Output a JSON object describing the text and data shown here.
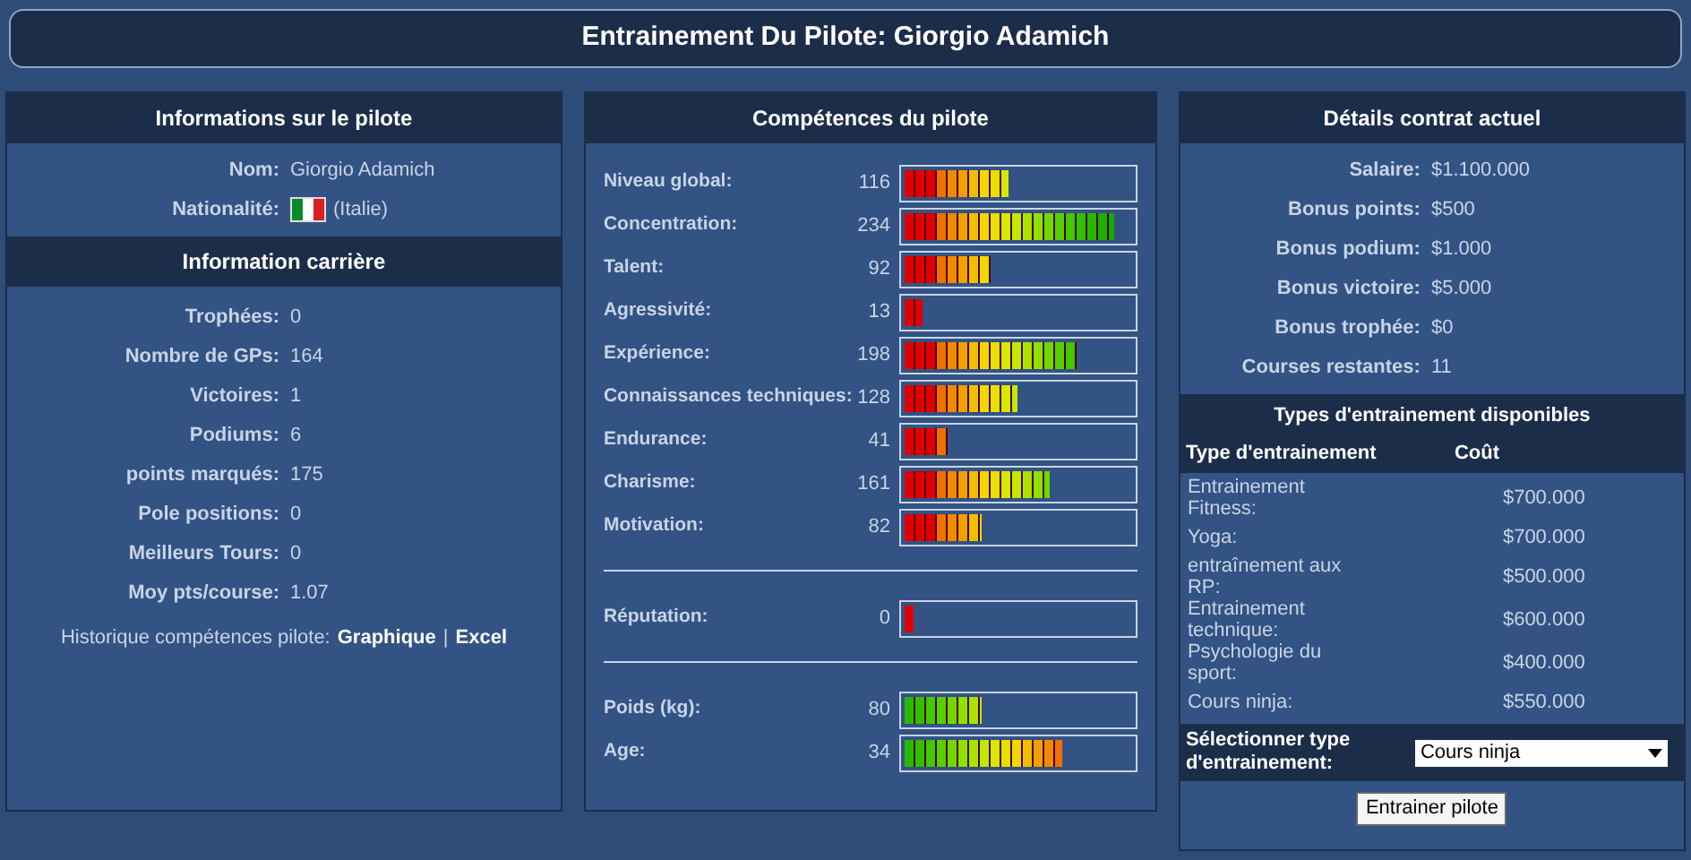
{
  "title": "Entrainement Du Pilote: Giorgio Adamich",
  "driver_info": {
    "title": "Informations sur le pilote",
    "fields": [
      {
        "kind": "text",
        "label": "Nom:",
        "value": "Giorgio Adamich"
      },
      {
        "kind": "flag",
        "label": "Nationalité:",
        "value": "(Italie)"
      }
    ]
  },
  "career": {
    "title": "Information carrière",
    "fields": [
      {
        "label": "Trophées:",
        "value": "0"
      },
      {
        "label": "Nombre de GPs:",
        "value": "164"
      },
      {
        "label": "Victoires:",
        "value": "1"
      },
      {
        "label": "Podiums:",
        "value": "6"
      },
      {
        "label": "points marqués:",
        "value": "175"
      },
      {
        "label": "Pole positions:",
        "value": "0"
      },
      {
        "label": "Meilleurs Tours:",
        "value": "0"
      },
      {
        "label": "Moy pts/course:",
        "value": "1.07"
      }
    ],
    "history": {
      "label": "Historique compétences pilote:",
      "links": [
        "Graphique",
        "Excel"
      ],
      "separator": "|"
    }
  },
  "skills": {
    "title": "Compétences du pilote",
    "groups": [
      [
        {
          "label": "Niveau global:",
          "value": "116",
          "level": 0.46,
          "kind": "skill"
        },
        {
          "label": "Concentration:",
          "value": "234",
          "level": 0.92,
          "kind": "skill"
        },
        {
          "label": "Talent:",
          "value": "92",
          "level": 0.38,
          "kind": "skill"
        },
        {
          "label": "Agressivité:",
          "value": "13",
          "level": 0.08,
          "kind": "skill"
        },
        {
          "label": "Expérience:",
          "value": "198",
          "level": 0.76,
          "kind": "skill"
        },
        {
          "label": "Connaissances techniques:",
          "value": "128",
          "level": 0.5,
          "kind": "skill"
        },
        {
          "label": "Endurance:",
          "value": "41",
          "level": 0.19,
          "kind": "skill"
        },
        {
          "label": "Charisme:",
          "value": "161",
          "level": 0.64,
          "kind": "skill"
        },
        {
          "label": "Motivation:",
          "value": "82",
          "level": 0.34,
          "kind": "skill"
        }
      ],
      [
        {
          "label": "Réputation:",
          "value": "0",
          "level": 0.04,
          "kind": "skill"
        }
      ],
      [
        {
          "label": "Poids (kg):",
          "value": "80",
          "level": 0.34,
          "kind": "physical"
        },
        {
          "label": "Age:",
          "value": "34",
          "level": 0.69,
          "kind": "physical"
        }
      ]
    ]
  },
  "contract": {
    "title": "Détails contrat actuel",
    "fields": [
      {
        "label": "Salaire:",
        "value": "$1.100.000"
      },
      {
        "label": "Bonus points:",
        "value": "$500"
      },
      {
        "label": "Bonus podium:",
        "value": "$1.000"
      },
      {
        "label": "Bonus victoire:",
        "value": "$5.000"
      },
      {
        "label": "Bonus trophée:",
        "value": "$0"
      },
      {
        "label": "Courses restantes:",
        "value": "11"
      }
    ]
  },
  "training": {
    "title": "Types d'entrainement disponibles",
    "columns": [
      "Type d'entrainement",
      "Coût"
    ],
    "rows": [
      {
        "name": "Entrainement Fitness:",
        "cost": "$700.000"
      },
      {
        "name": "Yoga:",
        "cost": "$700.000"
      },
      {
        "name": "entraînement aux RP:",
        "cost": "$500.000"
      },
      {
        "name": "Entrainement technique:",
        "cost": "$600.000"
      },
      {
        "name": "Psychologie du sport:",
        "cost": "$400.000"
      },
      {
        "name": "Cours ninja:",
        "cost": "$550.000"
      }
    ],
    "select": {
      "label": "Sélectionner type d'entrainement:",
      "value": "Cours ninja"
    },
    "button": "Entrainer pilote"
  }
}
